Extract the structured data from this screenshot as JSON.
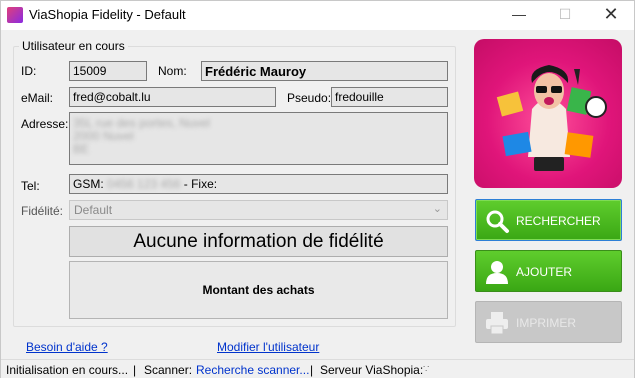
{
  "window": {
    "title": "ViaShopia Fidelity - Default",
    "minimize": "—",
    "maximize": "☐",
    "close": "✕"
  },
  "group": {
    "title": "Utilisateur en cours"
  },
  "form": {
    "id_label": "ID:",
    "id_value": "15009",
    "nom_label": "Nom:",
    "nom_value": "Frédéric Mauroy",
    "email_label": "eMail:",
    "email_value": "fred@cobalt.lu",
    "pseudo_label": "Pseudo:",
    "pseudo_value": "fredouille",
    "adresse_label": "Adresse:",
    "adresse_lines": [
      "35L rue des portes, Nuvel",
      "2000 Nuvel",
      "BE"
    ],
    "tel_label": "Tel:",
    "gsm_prefix": "GSM:",
    "gsm_value": "0456 123 456",
    "fixe_label": "- Fixe:",
    "fidelite_label": "Fidélité:",
    "fidelite_value": "Default",
    "fidelite_chevron": "⌄"
  },
  "info": {
    "message": "Aucune information de fidélité",
    "achats": "Montant des achats"
  },
  "buttons": {
    "search": "RECHERCHER",
    "add": "AJOUTER",
    "print": "IMPRIMER"
  },
  "links": {
    "help": "Besoin d'aide ?",
    "modify": "Modifier l'utilisateur"
  },
  "status": {
    "init": "Initialisation en cours...",
    "sep1": "|",
    "scanner_label": "Scanner:",
    "scanner_value": "Recherche scanner...",
    "sep2": "|",
    "server_label": "Serveur ViaShopia:"
  },
  "colors": {
    "accent_green": "#3aa714",
    "link_blue": "#0033cc",
    "promo_pink": "#e0157a"
  }
}
